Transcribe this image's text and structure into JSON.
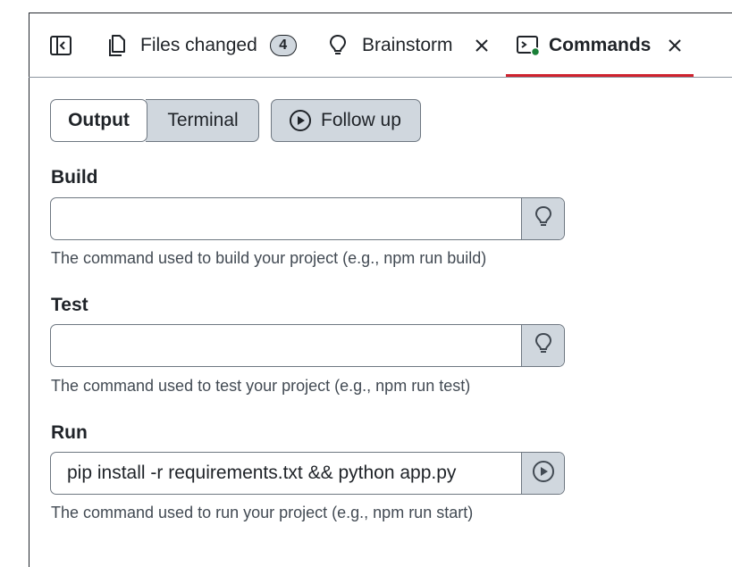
{
  "tabs": {
    "files_changed": {
      "label": "Files changed",
      "count": "4",
      "icon": "file-icon"
    },
    "brainstorm": {
      "label": "Brainstorm",
      "icon": "lightbulb-icon"
    },
    "commands": {
      "label": "Commands",
      "icon": "terminal-icon",
      "active": true
    },
    "sidebar_toggle_icon": "sidebar-toggle-icon",
    "close_icon": "close-icon"
  },
  "segmented": {
    "output_label": "Output",
    "terminal_label": "Terminal",
    "selected": "Output"
  },
  "follow_up": {
    "label": "Follow up",
    "icon": "play-circle-icon"
  },
  "fields": {
    "build": {
      "label": "Build",
      "value": "",
      "help": "The command used to build your project (e.g., npm run build)",
      "addon_icon": "lightbulb-icon"
    },
    "test": {
      "label": "Test",
      "value": "",
      "help": "The command used to test your project (e.g., npm run test)",
      "addon_icon": "lightbulb-icon"
    },
    "run": {
      "label": "Run",
      "value": "pip install -r requirements.txt && python app.py",
      "help": "The command used to run your project (e.g., npm run start)",
      "addon_icon": "play-circle-icon"
    }
  },
  "colors": {
    "active_tab_underline": "#cf222e",
    "status_dot": "#1a7f37",
    "button_bg": "#d0d7de"
  }
}
